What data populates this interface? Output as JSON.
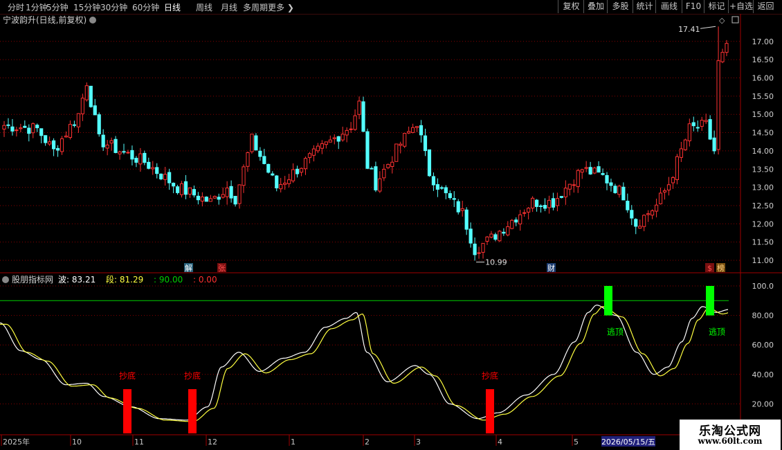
{
  "toolbar": {
    "periods": [
      "分时",
      "1分钟",
      "5分钟",
      "15分钟",
      "30分钟",
      "60分钟",
      "日线",
      "周线",
      "月线",
      "多周期",
      "更多"
    ],
    "active_period": "日线",
    "right_buttons": [
      "复权",
      "叠加",
      "多股",
      "统计",
      "画线",
      "F10",
      "标记",
      "+自选",
      "返回"
    ]
  },
  "chart_header": {
    "title": "宁波韵升(日线,前复权)"
  },
  "price_axis": {
    "ticks": [
      "17.00",
      "16.50",
      "16.00",
      "15.50",
      "15.00",
      "14.50",
      "14.00",
      "13.50",
      "13.00",
      "12.50",
      "12.00",
      "11.50",
      "11.00"
    ]
  },
  "annotations": {
    "high_label": "17.41",
    "low_label": "10.99"
  },
  "event_markers": [
    "解",
    "张",
    "财",
    "$",
    "榜"
  ],
  "indicator_header": {
    "name": "股朋指标网",
    "items": [
      {
        "label": "波:",
        "value": "83.21",
        "color": "#ffffff"
      },
      {
        "label": "段:",
        "value": "81.29",
        "color": "#ffff40"
      },
      {
        "label": ":",
        "value": "90.00",
        "color": "#00d000"
      },
      {
        "label": ":",
        "value": "0.00",
        "color": "#ff3030"
      }
    ]
  },
  "indicator_axis": {
    "ticks": [
      "100.0",
      "80.00",
      "60.00",
      "40.00",
      "20.00"
    ]
  },
  "signals": {
    "buy_label": "抄底",
    "sell_label": "逃顶"
  },
  "date_axis": {
    "labels": [
      "2025年",
      "10",
      "11",
      "12",
      "1",
      "2",
      "3",
      "4",
      "5"
    ],
    "current_date": "2026/05/15/五"
  },
  "watermark": {
    "title": "乐淘公式网",
    "url": "www.60lt.com"
  },
  "colors": {
    "up": "#ff3232",
    "down": "#54ffff",
    "grid": "#8b0000",
    "wave": "#ffffff",
    "segment": "#ffff40",
    "level": "#00d000",
    "buy": "#ff0000",
    "sell": "#00ff00"
  },
  "chart_data": {
    "type": "candlestick",
    "price_ylim": [
      10.8,
      17.6
    ],
    "high": 17.41,
    "low": 10.99,
    "indicator_ylim": [
      0,
      105
    ],
    "indicator_level": 90.0,
    "wave_last": 83.21,
    "segment_last": 81.29,
    "buy_signal_months": [
      "11",
      "12",
      "4"
    ],
    "sell_signal_months": [
      "5",
      "5"
    ]
  }
}
